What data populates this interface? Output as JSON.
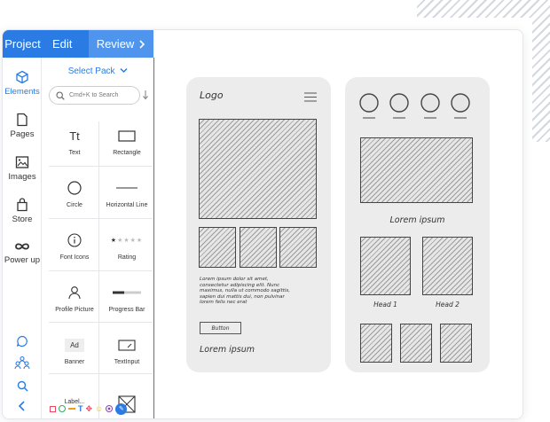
{
  "topbar": {
    "project": "Project",
    "edit": "Edit",
    "review": "Review"
  },
  "rail": {
    "items": [
      {
        "label": "Elements",
        "icon": "cube-icon"
      },
      {
        "label": "Pages",
        "icon": "page-icon"
      },
      {
        "label": "Images",
        "icon": "image-icon"
      },
      {
        "label": "Store",
        "icon": "bag-icon"
      },
      {
        "label": "Power up",
        "icon": "infinity-icon"
      }
    ]
  },
  "panel": {
    "select_pack": "Select Pack",
    "search_placeholder": "Cmd+K to Search",
    "elements": [
      "Text",
      "Rectangle",
      "Circle",
      "Horizontal Line",
      "Font Icons",
      "Rating",
      "Profile Picture",
      "Progress Bar",
      "Banner",
      "TextInput",
      "Label...",
      ""
    ],
    "text_glyph": "Tt",
    "banner_glyph": "Ad"
  },
  "canvas": {
    "phone1": {
      "logo": "Logo",
      "body": [
        "Lorem ipsum dolor sit amet,",
        "consectetur adipiscing elit. Nunc",
        "maximus, nulla ut commodo sagittis,",
        "sapien dui mattis dui, non pulvinar",
        "lorem felis nec erat"
      ],
      "button": "Button",
      "footer": "Lorem ipsum"
    },
    "phone2": {
      "title": "Lorem ipsum",
      "head1": "Head 1",
      "head2": "Head 2"
    }
  },
  "colors": {
    "primary": "#2a7be4",
    "primary_light": "#4f95ee"
  }
}
